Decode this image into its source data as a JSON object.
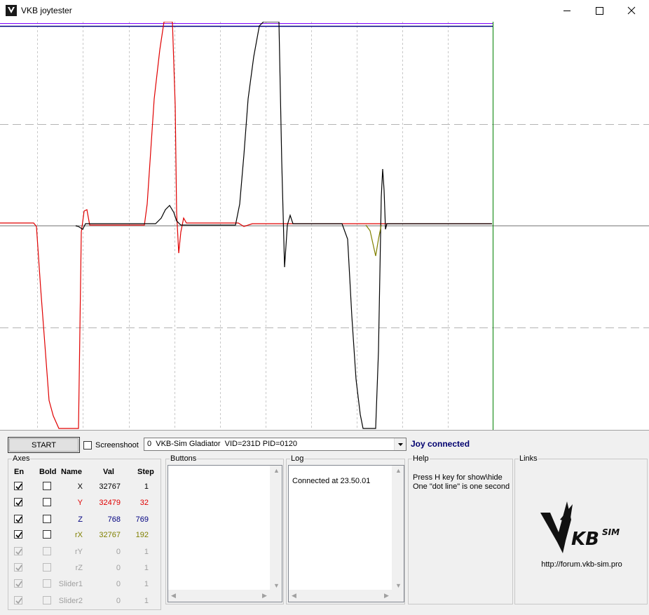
{
  "window": {
    "title": "VKB joytester"
  },
  "controls": {
    "start_label": "START",
    "screenshoot_label": "Screenshoot",
    "screenshoot_checked": false,
    "device": "0  VKB-Sim Gladiator  VID=231D PID=0120",
    "status": "Joy connected"
  },
  "colors": {
    "status": "#00006e",
    "Y": "#e00000",
    "Z": "#000080",
    "rX": "#808000",
    "disabled": "#a0a0a0",
    "plot_border_right": "#008000",
    "plot_top_line": "#8000ff"
  },
  "axes": {
    "title": "Axes",
    "headers": {
      "en": "En",
      "bold": "Bold",
      "name": "Name",
      "val": "Val",
      "step": "Step"
    },
    "rows": [
      {
        "name": "X",
        "val": "32767",
        "step": "1",
        "en": true,
        "bold": false,
        "enabled": true,
        "color": "#000000"
      },
      {
        "name": "Y",
        "val": "32479",
        "step": "32",
        "en": true,
        "bold": false,
        "enabled": true,
        "color": "#e00000"
      },
      {
        "name": "Z",
        "val": "768",
        "step": "769",
        "en": true,
        "bold": false,
        "enabled": true,
        "color": "#000080"
      },
      {
        "name": "rX",
        "val": "32767",
        "step": "192",
        "en": true,
        "bold": false,
        "enabled": true,
        "color": "#808000"
      },
      {
        "name": "rY",
        "val": "0",
        "step": "1",
        "en": true,
        "bold": false,
        "enabled": false,
        "color": "#a0a0a0"
      },
      {
        "name": "rZ",
        "val": "0",
        "step": "1",
        "en": true,
        "bold": false,
        "enabled": false,
        "color": "#a0a0a0"
      },
      {
        "name": "Slider1",
        "val": "0",
        "step": "1",
        "en": true,
        "bold": false,
        "enabled": false,
        "color": "#a0a0a0"
      },
      {
        "name": "Slider2",
        "val": "0",
        "step": "1",
        "en": true,
        "bold": false,
        "enabled": false,
        "color": "#a0a0a0"
      }
    ]
  },
  "buttons_group": {
    "title": "Buttons"
  },
  "log": {
    "title": "Log",
    "entries": [
      "Connected at 23.50.01"
    ]
  },
  "help": {
    "title": "Help",
    "lines": [
      "Press H key for show\\hide",
      "One \"dot line\" is one second"
    ]
  },
  "links": {
    "title": "Links",
    "logo_text": "KB SIM",
    "url": "http://forum.vkb-sim.pro"
  }
}
